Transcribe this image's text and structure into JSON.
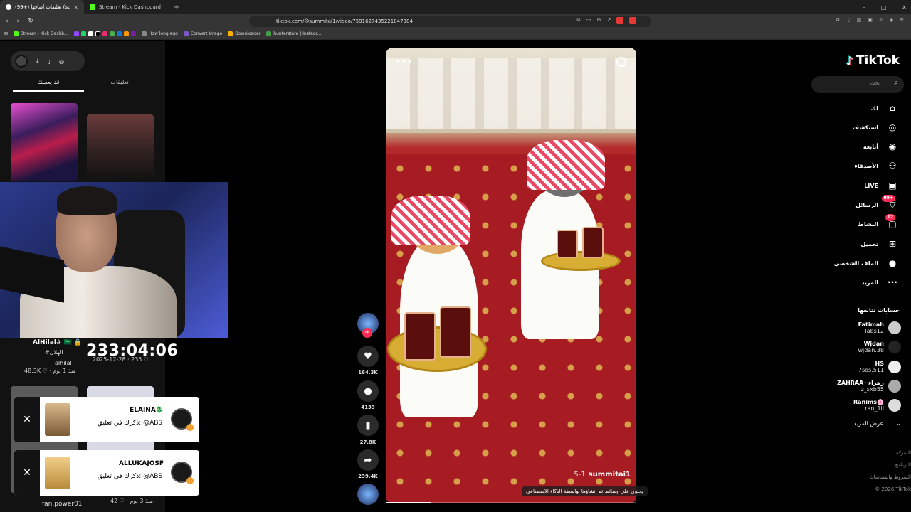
{
  "browser": {
    "tabs": [
      {
        "title": "(99+) تعليقات أضافها (summitai1",
        "active": true
      },
      {
        "title": "Stream - Kick Dashboard",
        "active": false
      }
    ],
    "new_tab": "+",
    "url": "tiktok.com/@summitai1/video/7591627435221847304",
    "window_controls": [
      "–",
      "□",
      "✕"
    ],
    "nav": [
      "‹",
      "›",
      "↻"
    ],
    "bookmarks": [
      "Stream - Kick Dashb...",
      "How long ago",
      "Convert Image",
      "Downloader",
      "hunterstore | Instagr..."
    ]
  },
  "left_panel": {
    "tabs": [
      "تعليقات",
      "قد يعجبك"
    ],
    "profile": {
      "name": "AlHilal# 🇸🇦 🔒",
      "hashtag": "#الهلال",
      "username": "alhilal",
      "meta": "48.3K ♡ · منذ 1 يوم",
      "date": "2025-12-28 · 235 ♡"
    },
    "timer": "233:04:06",
    "notifications": [
      {
        "who": "ELAINA🐉",
        "what": "ذكرك في تعليق: @ABS"
      },
      {
        "who": "ALLUKAJOSF",
        "what": "ذكرك في تعليق: @ABS"
      }
    ],
    "bottom_user": "fan.power01",
    "bottom_meta": "42 ♡ · منذ 3 يوم"
  },
  "video": {
    "author": "summitai1",
    "date": "5-1",
    "ai_label": "يحتوي على وسائط تم إنشاؤها بواسطة الذكاء الاصطناعي",
    "progress": 0.18
  },
  "actions": {
    "likes": "164.3K",
    "comments": "4133",
    "saves": "27.8K",
    "shares": "239.4K"
  },
  "right_nav": {
    "logo": "TikTok",
    "search_placeholder": "بحث",
    "items": [
      {
        "label": "لك",
        "icon": "home-icon"
      },
      {
        "label": "استكشف",
        "icon": "compass-icon"
      },
      {
        "label": "أتابعه",
        "icon": "following-avatar-icon"
      },
      {
        "label": "الأصدقاء",
        "icon": "friends-icon"
      },
      {
        "label": "LIVE",
        "icon": "live-icon"
      },
      {
        "label": "الرسائل",
        "icon": "messages-icon",
        "badge": "99+"
      },
      {
        "label": "النشاط",
        "icon": "activity-icon",
        "badge": "12"
      },
      {
        "label": "تحميل",
        "icon": "upload-icon"
      },
      {
        "label": "الملف الشخصي",
        "icon": "profile-icon"
      },
      {
        "label": "المزيد",
        "icon": "more-icon"
      }
    ],
    "following_title": "حسابات تتابعها",
    "accounts": [
      {
        "name": "Fatimah",
        "user": "labs12"
      },
      {
        "name": "Wjdan",
        "user": "wjdan.38"
      },
      {
        "name": "HS",
        "user": "7sos.511"
      },
      {
        "name": "ZAHRAA~زهراء",
        "user": "z_sxb55"
      },
      {
        "name": "Ranims🌸",
        "user": "ran_1il"
      }
    ],
    "show_more": "عرض المزيد",
    "footer": [
      "الشركة",
      "البرنامج",
      "الشروط والسياسات",
      "© 2026 TikTok"
    ]
  }
}
